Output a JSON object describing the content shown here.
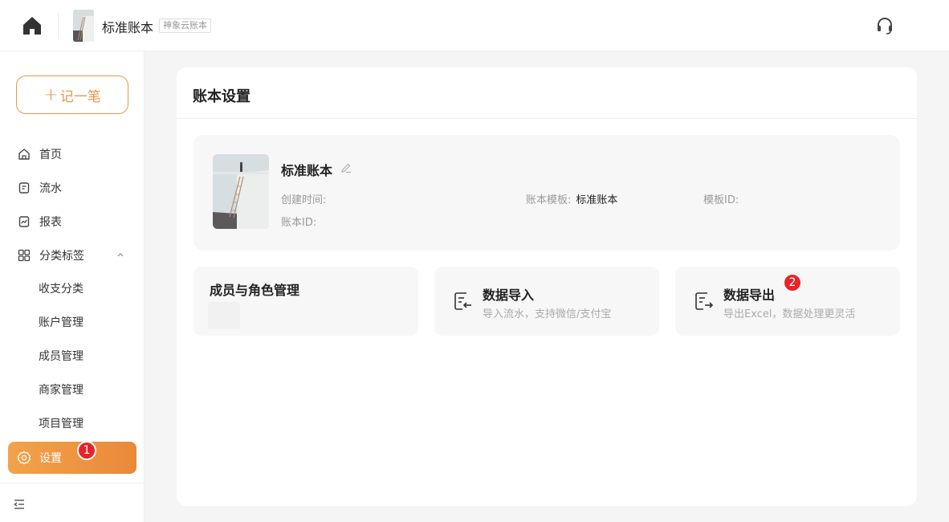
{
  "header": {
    "book_title": "标准账本",
    "book_tag": "神象云账本"
  },
  "sidebar": {
    "record_label": "记一笔",
    "items": [
      {
        "label": "首页",
        "icon": "home-outline-icon"
      },
      {
        "label": "流水",
        "icon": "bookmark-icon"
      },
      {
        "label": "报表",
        "icon": "chart-icon"
      },
      {
        "label": "分类标签",
        "icon": "grid-icon"
      }
    ],
    "sub_items": [
      "收支分类",
      "账户管理",
      "成员管理",
      "商家管理",
      "项目管理"
    ],
    "settings_label": "设置",
    "settings_badge": "1"
  },
  "panel": {
    "title": "账本设置",
    "book": {
      "name": "标准账本",
      "created_label": "创建时间:",
      "created_value": "",
      "template_label": "账本模板:",
      "template_value": "标准账本",
      "template_id_label": "模板ID:",
      "template_id_value": "",
      "book_id_label": "账本ID:",
      "book_id_value": ""
    },
    "cards": {
      "members_title": "成员与角色管理",
      "import_title": "数据导入",
      "import_sub": "导入流水，支持微信/支付宝",
      "export_title": "数据导出",
      "export_sub": "导出Excel，数据处理更灵活",
      "export_badge": "2"
    }
  },
  "colors": {
    "accent": "#e9893a",
    "badge": "#e8232a"
  }
}
